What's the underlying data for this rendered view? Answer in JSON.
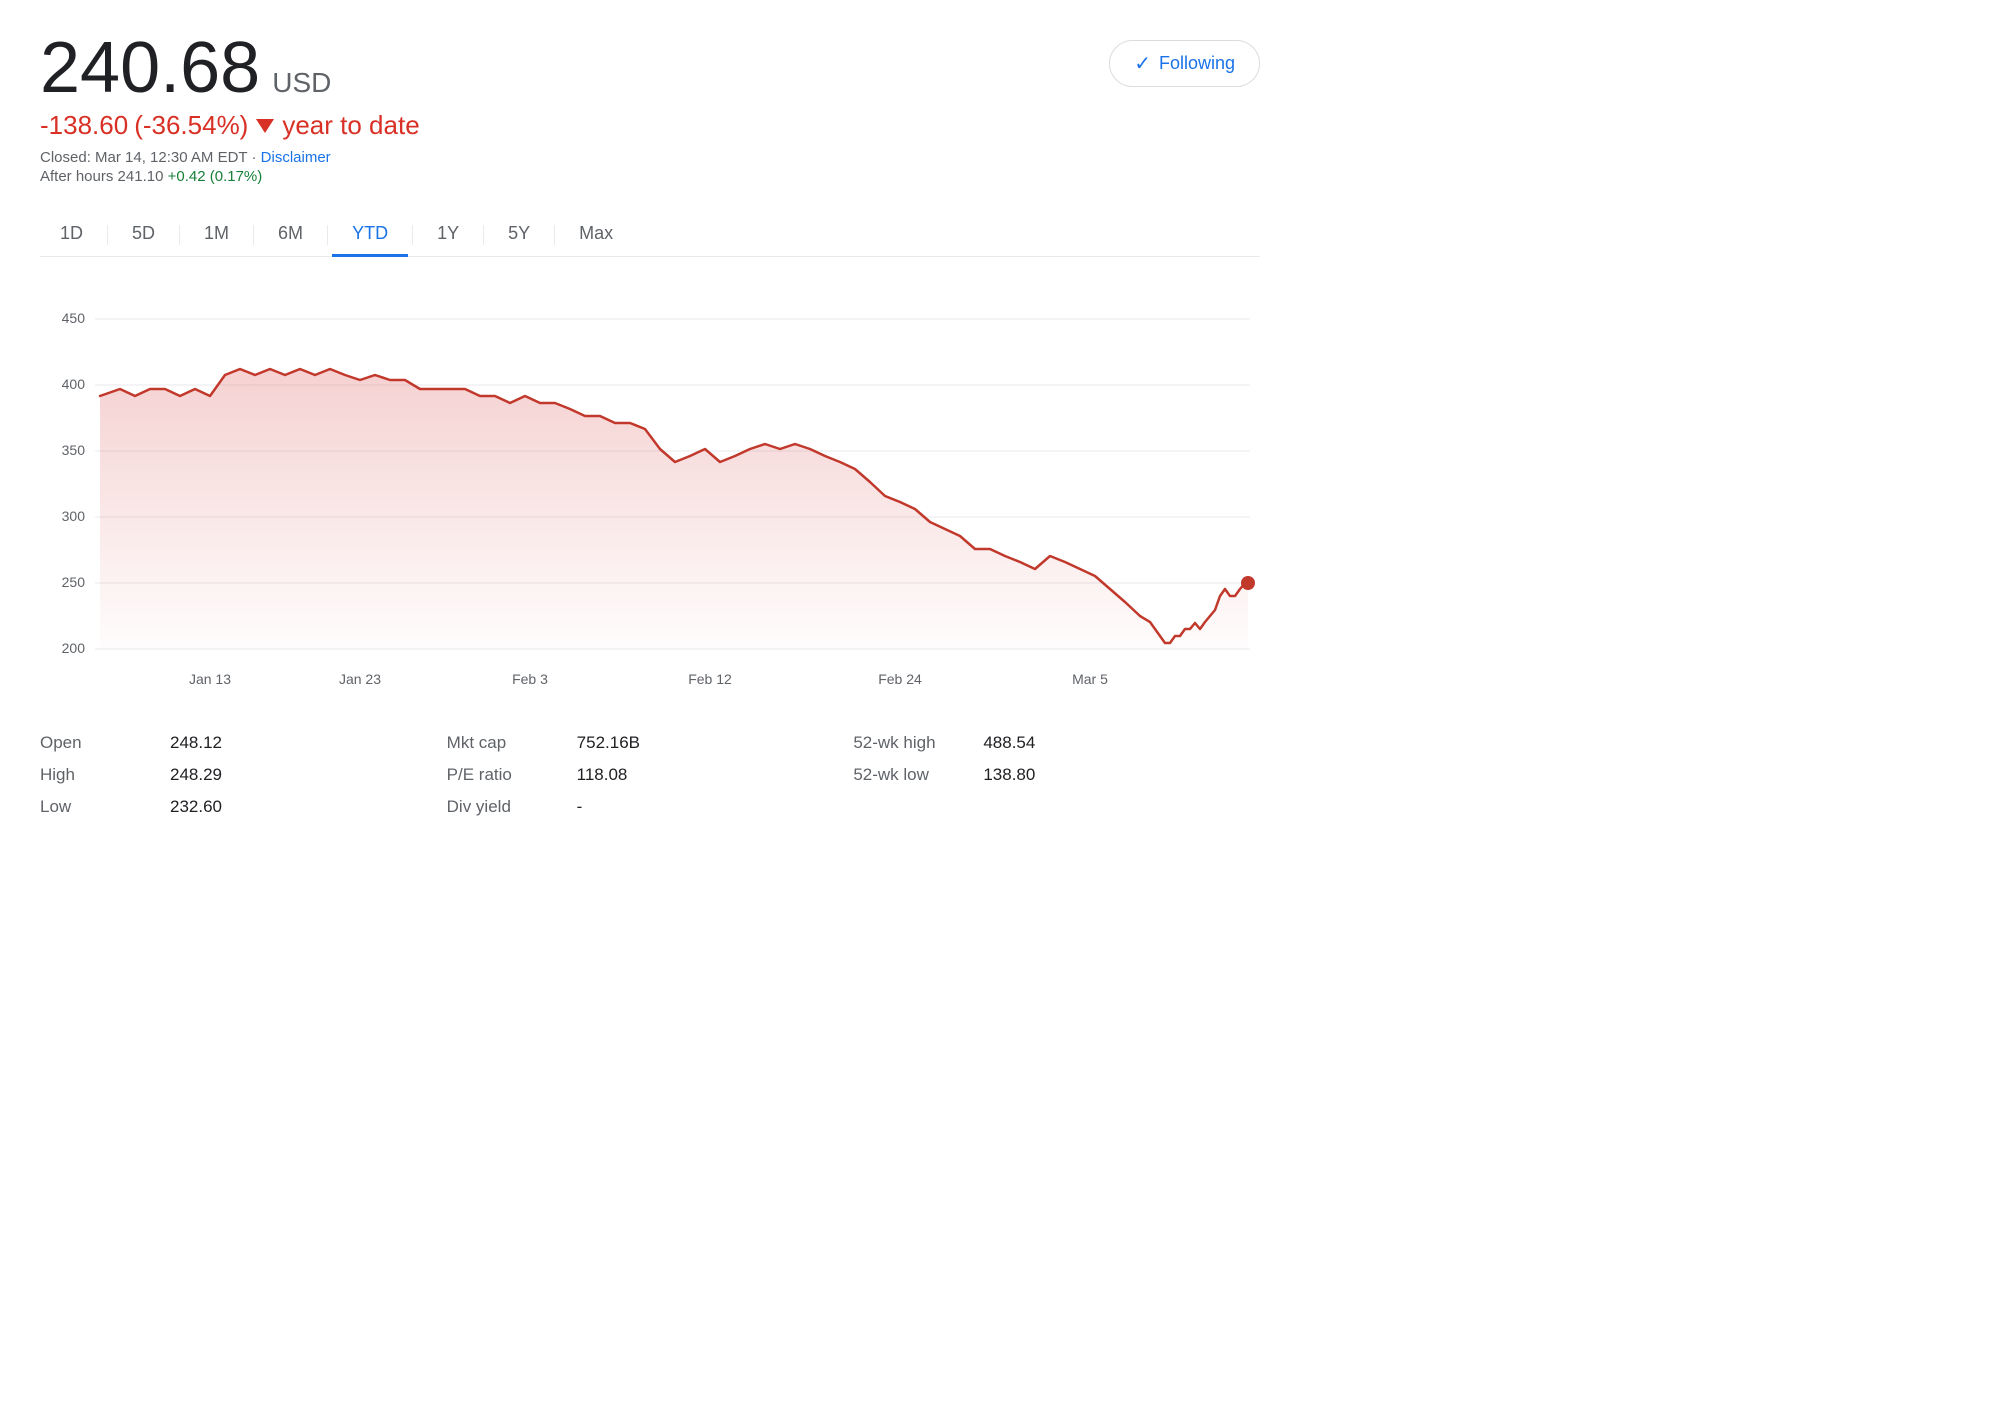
{
  "price": {
    "value": "240.68",
    "currency": "USD",
    "change_amount": "-138.60",
    "change_percent": "(-36.54%)",
    "change_direction": "down",
    "period_label": "year to date",
    "closed_label": "Closed: Mar 14, 12:30 AM EDT",
    "disclaimer_label": "Disclaimer",
    "after_hours_label": "After hours",
    "after_hours_price": "241.10",
    "after_hours_change": "+0.42 (0.17%)"
  },
  "following_button": {
    "label": "Following",
    "icon": "✓"
  },
  "tabs": [
    {
      "label": "1D",
      "active": false
    },
    {
      "label": "5D",
      "active": false
    },
    {
      "label": "1M",
      "active": false
    },
    {
      "label": "6M",
      "active": false
    },
    {
      "label": "YTD",
      "active": true
    },
    {
      "label": "1Y",
      "active": false
    },
    {
      "label": "5Y",
      "active": false
    },
    {
      "label": "Max",
      "active": false
    }
  ],
  "chart": {
    "y_labels": [
      "450",
      "400",
      "350",
      "300",
      "250",
      "200"
    ],
    "x_labels": [
      "Jan 13",
      "Jan 23",
      "Feb 3",
      "Feb 12",
      "Feb 24",
      "Mar 5"
    ],
    "line_color": "#c0392b",
    "fill_color_top": "rgba(211,47,47,0.18)",
    "fill_color_bottom": "rgba(211,47,47,0.01)"
  },
  "stats": {
    "col1": [
      {
        "label": "Open",
        "value": "248.12"
      },
      {
        "label": "High",
        "value": "248.29"
      },
      {
        "label": "Low",
        "value": "232.60"
      }
    ],
    "col2": [
      {
        "label": "Mkt cap",
        "value": "752.16B"
      },
      {
        "label": "P/E ratio",
        "value": "118.08"
      },
      {
        "label": "Div yield",
        "value": "-"
      }
    ],
    "col3": [
      {
        "label": "52-wk high",
        "value": "488.54"
      },
      {
        "label": "52-wk low",
        "value": "138.80"
      }
    ]
  }
}
